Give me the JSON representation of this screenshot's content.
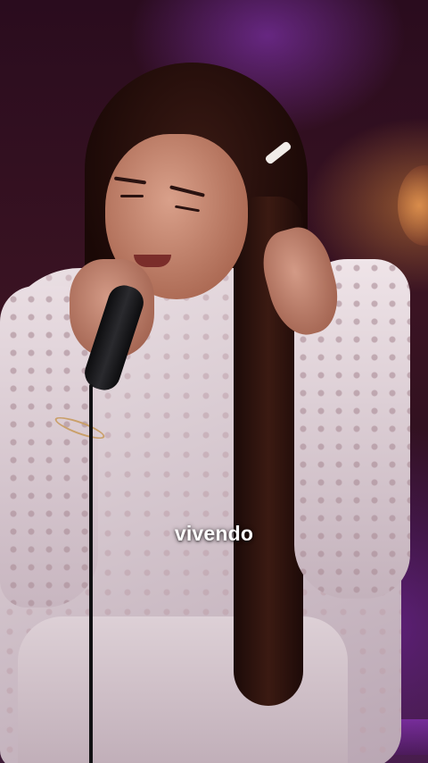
{
  "video": {
    "caption": "vivendo"
  },
  "colors": {
    "caption_text": "#ffffff",
    "stage_light_purple": "#9a3cd2",
    "stage_light_orange": "#ff9a4a"
  }
}
